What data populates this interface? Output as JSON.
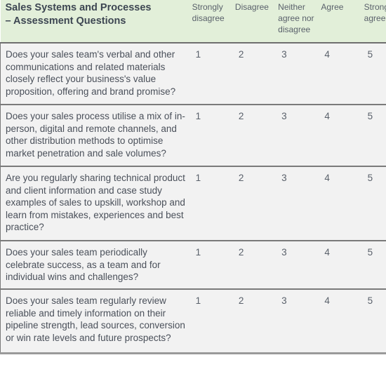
{
  "header": {
    "title": "Sales Systems and Processes",
    "subtitle": "– Assessment Questions",
    "scale_labels": [
      "Strongly disagree",
      "Disagree",
      "Neither agree nor disagree",
      "Agree",
      "Strongly agree"
    ],
    "scale_label_lines": [
      [
        "Strongly",
        "disagree"
      ],
      [
        "Disagree"
      ],
      [
        "Neither",
        "agree nor",
        "disagree"
      ],
      [
        "Agree"
      ],
      [
        "Strongly",
        "agree"
      ]
    ]
  },
  "questions": [
    {
      "text": "Does your sales team's verbal and other communications and related materials closely reflect your business's value proposition, offering and brand promise?",
      "scores": [
        "1",
        "2",
        "3",
        "4",
        "5"
      ]
    },
    {
      "text": "Does your sales process utilise a mix of in-person, digital and remote channels, and other distribution methods to optimise market penetration and sale volumes?",
      "scores": [
        "1",
        "2",
        "3",
        "4",
        "5"
      ]
    },
    {
      "text": "Are you regularly sharing technical product and client information and case study examples of sales to upskill, workshop and learn from mistakes, experiences and best practice?",
      "scores": [
        "1",
        "2",
        "3",
        "4",
        "5"
      ]
    },
    {
      "text": "Does your sales team periodically celebrate success, as a team and for individual wins and challenges?",
      "scores": [
        "1",
        "2",
        "3",
        "4",
        "5"
      ]
    },
    {
      "text": "Does your sales team regularly review reliable and timely information on their pipeline strength, lead sources, conversion or win rate levels and future prospects?",
      "scores": [
        "1",
        "2",
        "3",
        "4",
        "5"
      ]
    }
  ],
  "colors": {
    "header_bg": "#e2efd9",
    "row_bg": "#f2f2f2",
    "text": "#4a505a"
  }
}
